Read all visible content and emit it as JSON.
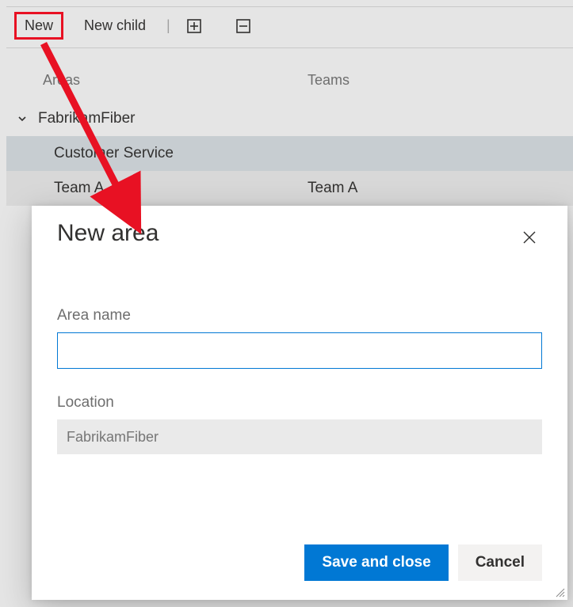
{
  "toolbar": {
    "new_label": "New",
    "new_child_label": "New child"
  },
  "headers": {
    "areas": "Areas",
    "teams": "Teams"
  },
  "tree": {
    "root_name": "FabrikamFiber",
    "rows": [
      {
        "area": "Customer Service",
        "team": ""
      },
      {
        "area": "Team A",
        "team": "Team A"
      }
    ]
  },
  "dialog": {
    "title": "New area",
    "area_name_label": "Area name",
    "area_name_value": "",
    "location_label": "Location",
    "location_value": "FabrikamFiber",
    "save_label": "Save and close",
    "cancel_label": "Cancel"
  },
  "colors": {
    "accent": "#0178d4",
    "highlight": "#e81123"
  }
}
